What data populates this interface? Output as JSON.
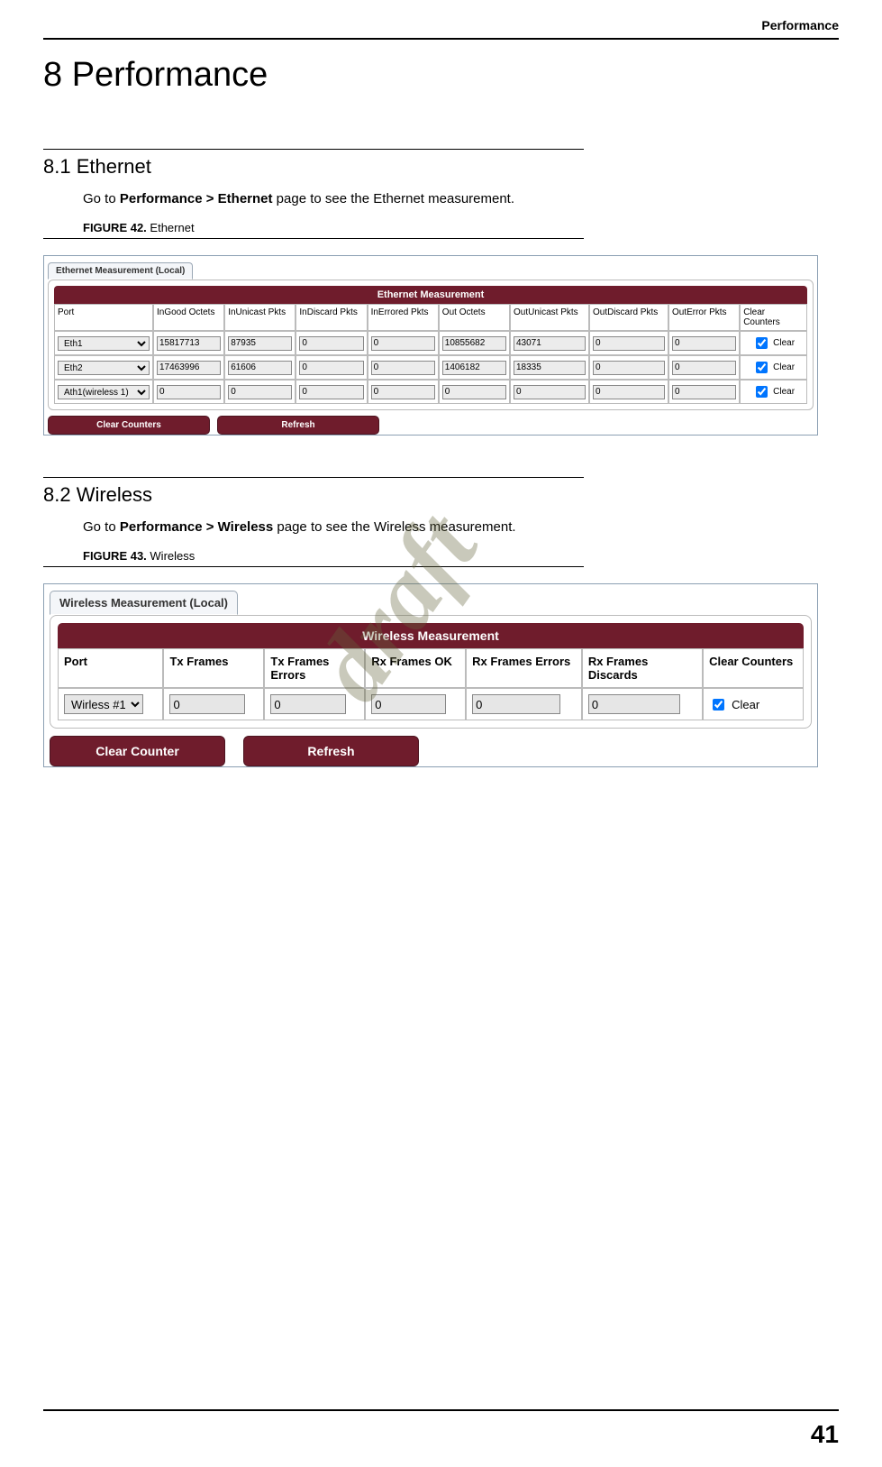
{
  "header": {
    "running": "Performance"
  },
  "chapter": {
    "title": "8 Performance"
  },
  "ethernet": {
    "section_title": "8.1 Ethernet",
    "intro_pre": "Go to ",
    "intro_bold": "Performance > Ethernet",
    "intro_post": " page to see the Ethernet measurement.",
    "figure_label": "FIGURE 42.",
    "figure_name": " Ethernet",
    "tab": "Ethernet Measurement (Local)",
    "panel_title": "Ethernet Measurement",
    "columns": [
      "Port",
      "InGood Octets",
      "InUnicast Pkts",
      "InDiscard Pkts",
      "InErrored Pkts",
      "Out Octets",
      "OutUnicast Pkts",
      "OutDiscard Pkts",
      "OutError Pkts",
      "Clear Counters"
    ],
    "rows": [
      {
        "port": "Eth1",
        "inGoodOctets": "15817713",
        "inUnicastPkts": "87935",
        "inDiscardPkts": "0",
        "inErroredPkts": "0",
        "outOctets": "10855682",
        "outUnicastPkts": "43071",
        "outDiscardPkts": "0",
        "outErrorPkts": "0",
        "clear": "Clear"
      },
      {
        "port": "Eth2",
        "inGoodOctets": "17463996",
        "inUnicastPkts": "61606",
        "inDiscardPkts": "0",
        "inErroredPkts": "0",
        "outOctets": "1406182",
        "outUnicastPkts": "18335",
        "outDiscardPkts": "0",
        "outErrorPkts": "0",
        "clear": "Clear"
      },
      {
        "port": "Ath1(wireless 1)",
        "inGoodOctets": "0",
        "inUnicastPkts": "0",
        "inDiscardPkts": "0",
        "inErroredPkts": "0",
        "outOctets": "0",
        "outUnicastPkts": "0",
        "outDiscardPkts": "0",
        "outErrorPkts": "0",
        "clear": "Clear"
      }
    ],
    "btn_clear": "Clear Counters",
    "btn_refresh": "Refresh"
  },
  "wireless": {
    "section_title": "8.2 Wireless",
    "intro_pre": "Go to ",
    "intro_bold": "Performance > Wireless",
    "intro_post": " page to see the Wireless measurement.",
    "figure_label": "FIGURE 43.",
    "figure_name": " Wireless",
    "tab": "Wireless Measurement (Local)",
    "panel_title": "Wireless Measurement",
    "columns": [
      "Port",
      "Tx Frames",
      "Tx Frames Errors",
      "Rx Frames OK",
      "Rx Frames Errors",
      "Rx Frames Discards",
      "Clear Counters"
    ],
    "row": {
      "port": "Wirless #1",
      "tx": "0",
      "txErr": "0",
      "rxOk": "0",
      "rxErr": "0",
      "rxDisc": "0",
      "clear": "Clear"
    },
    "btn_clear": "Clear Counter",
    "btn_refresh": "Refresh"
  },
  "watermark": "draft",
  "page_number": "41"
}
